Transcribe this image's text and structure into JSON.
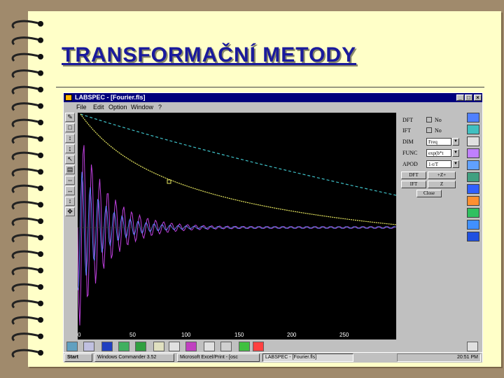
{
  "slide": {
    "title": "TRANSFORMAČNÍ METODY"
  },
  "window": {
    "title": "LABSPEC - [Fourier.fls]",
    "controls": [
      "_",
      "□",
      "×"
    ]
  },
  "menu": [
    "File",
    "Edit",
    "Option",
    "Window",
    "?"
  ],
  "tools": [
    "✎",
    "□",
    "↕",
    "↨",
    "↖",
    "▤",
    "⇔",
    "↔",
    "↕",
    "✥"
  ],
  "plot": {
    "x_ticks": [
      "0",
      "50",
      "100",
      "150",
      "200",
      "250"
    ]
  },
  "panel": {
    "rows": [
      {
        "label": "DFT",
        "type": "check",
        "value": "No"
      },
      {
        "label": "IFT",
        "type": "check",
        "value": "No"
      },
      {
        "label": "DIM",
        "type": "select",
        "value": "Freq"
      },
      {
        "label": "FUNC",
        "type": "select",
        "value": "exp(b*t"
      },
      {
        "label": "APOD",
        "type": "select",
        "value": "1-t/T"
      }
    ],
    "buttons": [
      {
        "a": "DFT",
        "b": "+Z+"
      },
      {
        "a": "IFT",
        "b": "Z"
      }
    ],
    "close_label": "Close"
  },
  "taskbar": {
    "start": "Start",
    "tasks": [
      "Windows Commander 3.52",
      "Microsoft Excel/Print - [osc",
      "LABSPEC - [Fourier.fls]"
    ],
    "clock": "20:51 PM"
  },
  "colors": {
    "plot_bg": "#000000",
    "curve_dashed": "#3fc1c8",
    "curve_yellow": "#e8e860",
    "curve_magenta": "#c040e0",
    "curve_blue": "#6080ff",
    "title_blue": "#1a1a9c"
  }
}
